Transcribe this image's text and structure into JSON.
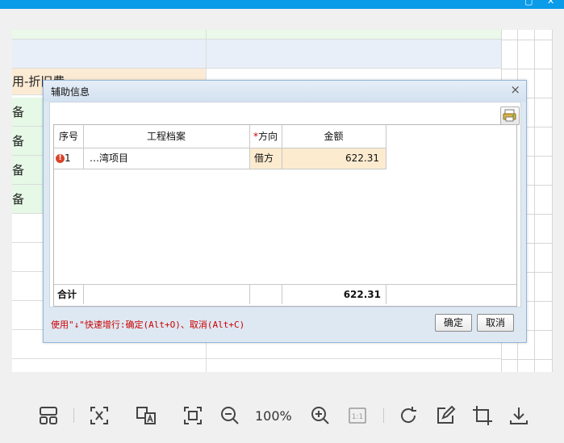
{
  "window": {
    "restore_glyph": "▢",
    "close_glyph": "✕"
  },
  "sheet": {
    "partial_rows": [
      "用-折旧费",
      "备",
      "备",
      "备",
      "备"
    ]
  },
  "dialog": {
    "title": "辅助信息",
    "close_glyph": "×",
    "toolbar_icon": "print-settings-icon",
    "columns": {
      "seq": "序号",
      "project": "工程档案",
      "direction_required": "*",
      "direction": "方向",
      "amount": "金额"
    },
    "rows": [
      {
        "seq": "1",
        "project": "…湾项目",
        "direction": "借方",
        "amount": "622.31",
        "status_icon": "error-icon"
      }
    ],
    "footer": {
      "label": "合计",
      "total": "622.31"
    },
    "hint": "使用\"↓\"快速增行:确定(Alt+O)、取消(Alt+C)",
    "ok_label": "确定",
    "cancel_label": "取消"
  },
  "viewer": {
    "zoom": "100%",
    "one_to_one_label": "1:1"
  },
  "colors": {
    "titlebar": "#0a9be9",
    "amount_bg": "#fdebd0",
    "hint": "#cc0000"
  }
}
